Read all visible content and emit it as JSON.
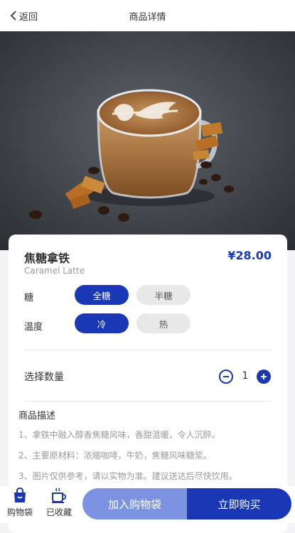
{
  "header": {
    "back_label": "返回",
    "title": "商品详情"
  },
  "product": {
    "name": "焦糖拿铁",
    "name_en": "Caramel Latte",
    "price": "¥28.00"
  },
  "options": [
    {
      "label": "糖",
      "choices": [
        "全糖",
        "半糖"
      ],
      "selected": "全糖"
    },
    {
      "label": "温度",
      "choices": [
        "冷",
        "热"
      ],
      "selected": "冷"
    }
  ],
  "quantity": {
    "label": "选择数量",
    "value": "1"
  },
  "description": {
    "title": "商品描述",
    "lines": [
      "1、拿铁中融入醇香焦糖风味，香甜温暖，令人沉醉。",
      "2、主要原材料：浓缩咖啡，牛奶，焦糖风味糖浆。",
      "3、图片仅供参考，请以实物为准。建议送达后尽快饮用。"
    ]
  },
  "bottom_bar": {
    "bag_label": "购物袋",
    "fav_label": "已收藏",
    "add_to_bag": "加入购物袋",
    "buy_now": "立即购买"
  },
  "colors": {
    "accent": "#1a38b5",
    "accent_light": "#7b93e0",
    "chip_inactive": "#e8e8e8"
  },
  "icons": [
    "chevron-left-icon",
    "shopping-bag-icon",
    "coffee-cup-icon",
    "minus-icon",
    "plus-icon"
  ]
}
